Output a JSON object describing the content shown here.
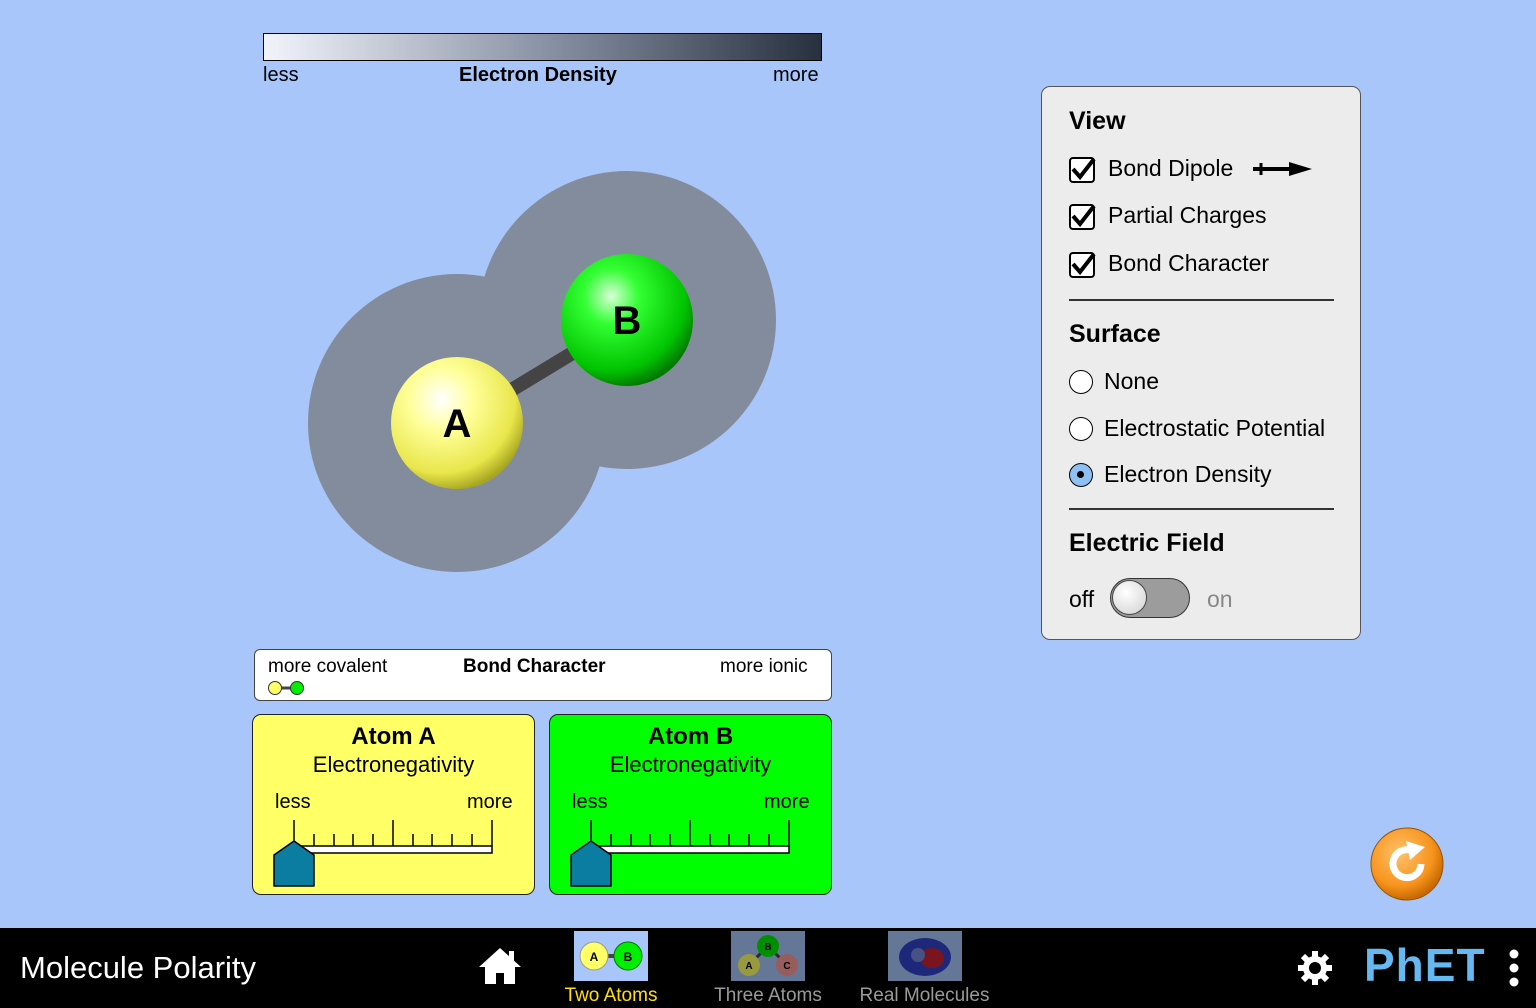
{
  "density_legend": {
    "less": "less",
    "title": "Electron Density",
    "more": "more"
  },
  "molecule": {
    "atom_a": "A",
    "atom_b": "B"
  },
  "control_panel": {
    "view_heading": "View",
    "view_options": [
      {
        "label": "Bond Dipole",
        "checked": true
      },
      {
        "label": "Partial Charges",
        "checked": true
      },
      {
        "label": "Bond Character",
        "checked": true
      }
    ],
    "surface_heading": "Surface",
    "surface_options": [
      {
        "label": "None",
        "selected": false
      },
      {
        "label": "Electrostatic Potential",
        "selected": false
      },
      {
        "label": "Electron Density",
        "selected": true
      }
    ],
    "field_heading": "Electric Field",
    "toggle_off": "off",
    "toggle_on": "on",
    "electric_field_on": false
  },
  "bond_character": {
    "left": "more covalent",
    "title": "Bond Character",
    "right": "more ionic",
    "value": 0
  },
  "atom_a_panel": {
    "title": "Atom A",
    "subtitle": "Electronegativity",
    "less": "less",
    "more": "more",
    "value": 0
  },
  "atom_b_panel": {
    "title": "Atom B",
    "subtitle": "Electronegativity",
    "less": "less",
    "more": "more",
    "value": 0
  },
  "navbar": {
    "app_title": "Molecule Polarity",
    "screens": [
      {
        "label": "Two Atoms",
        "active": true
      },
      {
        "label": "Three Atoms",
        "active": false
      },
      {
        "label": "Real Molecules",
        "active": false
      }
    ],
    "brand": "PhET"
  },
  "colors": {
    "background": "#a8c6fa",
    "atom_a": "#ffff66",
    "atom_b": "#00ff00",
    "slider_thumb": "#0b7da0",
    "active_screen": "#ffe000",
    "reset": "#f7941d"
  }
}
